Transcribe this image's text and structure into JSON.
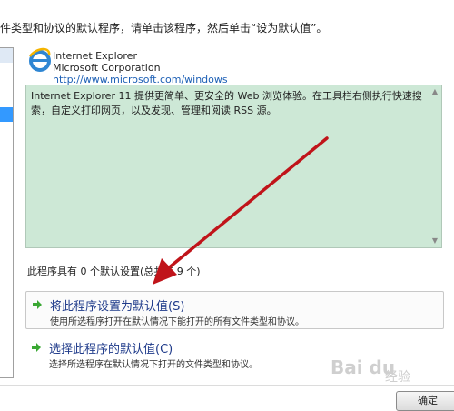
{
  "instruction": "件类型和协议的默认程序，请单击该程序，然后单击“设为默认值”。",
  "program": {
    "name": "Internet Explorer",
    "company": "Microsoft Corporation",
    "url": "http://www.microsoft.com/windows",
    "description": "Internet Explorer 11 提供更简单、更安全的 Web 浏览体验。在工具栏右侧执行快速搜索，自定义打印网页，以及发现、管理和阅读 RSS 源。"
  },
  "status": "此程序具有 0 个默认设置(总共有 9 个)",
  "commands": [
    {
      "title": "将此程序设置为默认值(S)",
      "subtitle": "使用所选程序打开在默认情况下能打开的所有文件类型和协议。"
    },
    {
      "title": "选择此程序的默认值(C)",
      "subtitle": "选择所选程序在默认情况下打开的文件类型和协议。"
    }
  ],
  "ok_button": "确定",
  "colors": {
    "link": "#1c5fb5",
    "desc_bg": "#cde8d6",
    "cmd_title": "#1e3a8a",
    "arrow": "#c0141a",
    "cmd_arrow": "#3aa833"
  },
  "watermark": {
    "text": "Bai du",
    "sub": "经验"
  }
}
